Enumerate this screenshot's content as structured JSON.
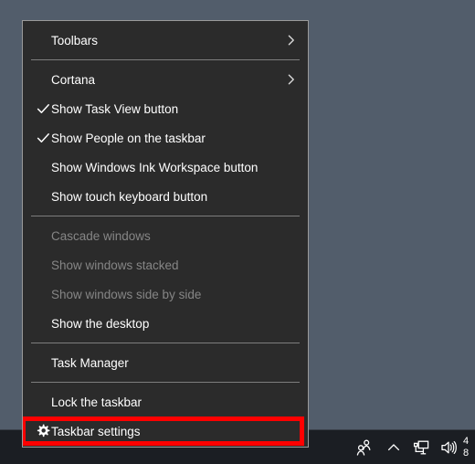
{
  "desktop": {
    "background_color": "#525d6b"
  },
  "context_menu": {
    "name": "taskbar-context-menu",
    "background_color": "#2b2b2b",
    "border_color": "#9a9a9a",
    "groups": [
      {
        "items": [
          {
            "label": "Toolbars",
            "icon": "chevron-right-icon",
            "has_submenu": true,
            "checked": false,
            "enabled": true
          }
        ]
      },
      {
        "items": [
          {
            "label": "Cortana",
            "icon": "chevron-right-icon",
            "has_submenu": true,
            "checked": false,
            "enabled": true
          },
          {
            "label": "Show Task View button",
            "icon": "check-icon",
            "has_submenu": false,
            "checked": true,
            "enabled": true
          },
          {
            "label": "Show People on the taskbar",
            "icon": "check-icon",
            "has_submenu": false,
            "checked": true,
            "enabled": true
          },
          {
            "label": "Show Windows Ink Workspace button",
            "icon": "",
            "has_submenu": false,
            "checked": false,
            "enabled": true
          },
          {
            "label": "Show touch keyboard button",
            "icon": "",
            "has_submenu": false,
            "checked": false,
            "enabled": true
          }
        ]
      },
      {
        "items": [
          {
            "label": "Cascade windows",
            "icon": "",
            "has_submenu": false,
            "checked": false,
            "enabled": false
          },
          {
            "label": "Show windows stacked",
            "icon": "",
            "has_submenu": false,
            "checked": false,
            "enabled": false
          },
          {
            "label": "Show windows side by side",
            "icon": "",
            "has_submenu": false,
            "checked": false,
            "enabled": false
          },
          {
            "label": "Show the desktop",
            "icon": "",
            "has_submenu": false,
            "checked": false,
            "enabled": true
          }
        ]
      },
      {
        "items": [
          {
            "label": "Task Manager",
            "icon": "",
            "has_submenu": false,
            "checked": false,
            "enabled": true
          }
        ]
      },
      {
        "items": [
          {
            "label": "Lock the taskbar",
            "icon": "",
            "has_submenu": false,
            "checked": false,
            "enabled": true
          },
          {
            "label": "Taskbar settings",
            "icon": "gear-icon",
            "has_submenu": false,
            "checked": false,
            "enabled": true,
            "highlighted": true
          }
        ]
      }
    ]
  },
  "annotation": {
    "color": "#ff0000",
    "target_label": "Taskbar settings"
  },
  "taskbar": {
    "background_color": "#1b1e23",
    "tray": {
      "items": [
        {
          "name": "people-icon",
          "tooltip": "People"
        },
        {
          "name": "chevron-up-icon",
          "tooltip": "Show hidden icons"
        },
        {
          "name": "network-icon",
          "tooltip": "Network"
        },
        {
          "name": "volume-icon",
          "tooltip": "Volume"
        }
      ],
      "clock": {
        "time": "4",
        "date": "8"
      }
    }
  }
}
